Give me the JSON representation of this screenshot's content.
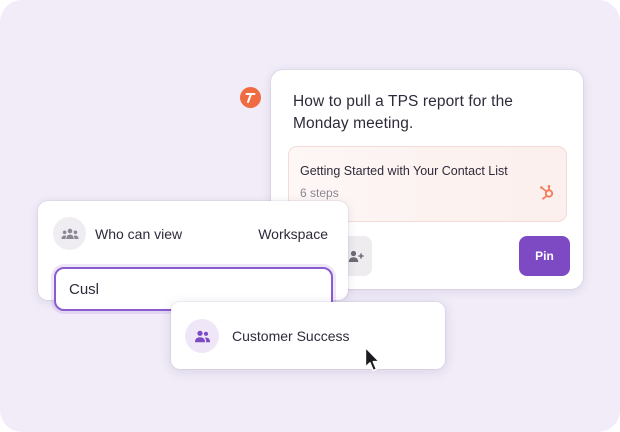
{
  "card": {
    "title": "How to pull a TPS report for the Monday meeting.",
    "guide": {
      "title": "Getting Started with Your Contact List",
      "steps": "6 steps"
    },
    "pin_label": "Pin"
  },
  "permissions": {
    "label": "Who can view",
    "value": "Workspace",
    "input_value": "Cusl"
  },
  "suggestion": {
    "label": "Customer Success"
  },
  "icons": {
    "brand": "brand-logo-icon",
    "hubspot": "hubspot-icon",
    "people": "people-icon",
    "team": "team-icon",
    "cursor": "mouse-pointer-icon"
  },
  "colors": {
    "background": "#f1ecf8",
    "accent": "#7d4ac4",
    "brand": "#f06b42",
    "hubspot": "#f57a53"
  }
}
